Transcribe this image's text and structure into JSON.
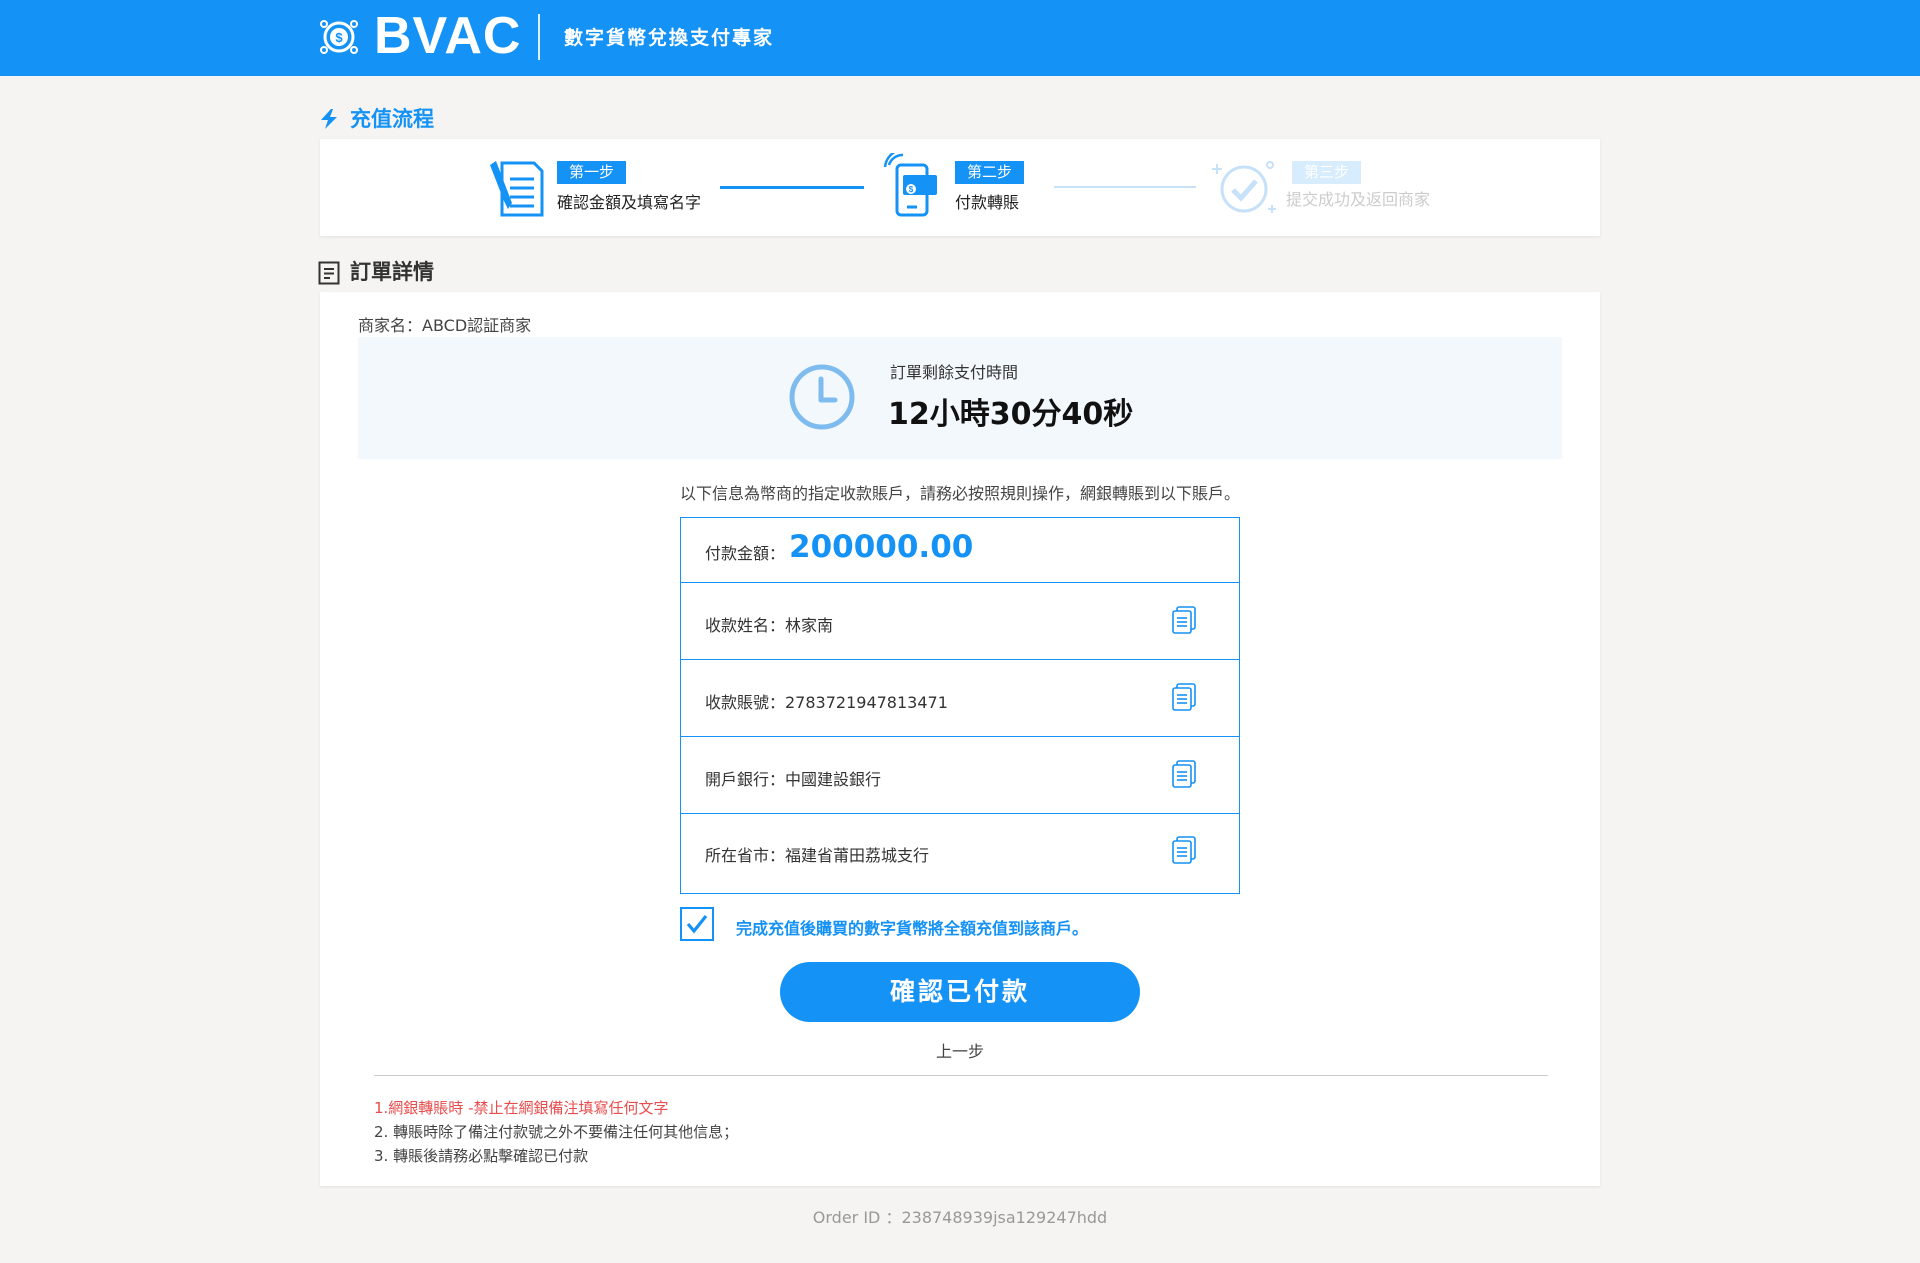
{
  "header": {
    "logo_text": "BVAC",
    "slogan": "數字貨幣兌換支付專家"
  },
  "process": {
    "title": "充值流程",
    "steps": [
      {
        "badge": "第一步",
        "label": "確認金額及填寫名字",
        "active": true,
        "icon": "form-edit-icon"
      },
      {
        "badge": "第二步",
        "label": "付款轉賬",
        "active": true,
        "icon": "mobile-payment-icon"
      },
      {
        "badge": "第三步",
        "label": "提交成功及返回商家",
        "active": false,
        "icon": "check-success-icon"
      }
    ]
  },
  "order": {
    "title": "訂單詳情",
    "merchant": "商家名：ABCD認証商家",
    "timer_label": "訂單剩餘支付時間",
    "timer_value": "12小時30分40秒",
    "notice": "以下信息為幣商的指定收款賬戶，請務必按照規則操作，網銀轉賬到以下賬戶。",
    "amount_label": "付款金額：",
    "amount_value": "200000.00",
    "rows": [
      {
        "text": "收款姓名：林家南"
      },
      {
        "text": "收款賬號：2783721947813471"
      },
      {
        "text": "開戶銀行：中國建設銀行"
      },
      {
        "text": "所在省市：福建省莆田荔城支行"
      }
    ],
    "agree_text": "完成充值後購買的數字貨幣將全額充值到該商戶。",
    "agree_checked": true,
    "confirm_button": "確認已付款",
    "prev_link": "上一步",
    "rules": [
      "1.網銀轉賬時 -禁止在網銀備注填寫任何文字",
      "2. 轉賬時除了備注付款號之外不要備注任何其他信息；",
      "3. 轉賬後請務必點擊確認已付款"
    ]
  },
  "footer": {
    "order_id": "Order ID ：238748939jsa129247hdd"
  },
  "colors": {
    "primary": "#1592f5",
    "warning": "#e84c4c",
    "background": "#f5f4f2"
  }
}
